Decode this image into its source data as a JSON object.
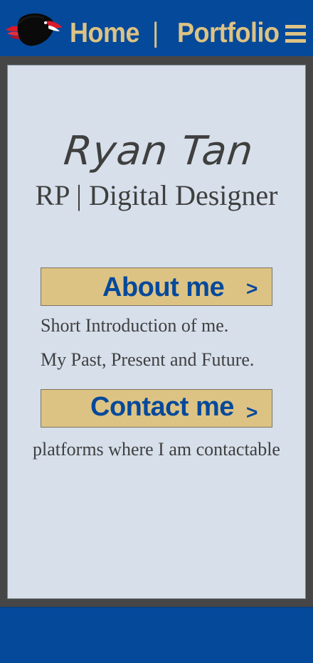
{
  "header": {
    "logo_icon": "eagle-logo-icon",
    "nav": {
      "home": "Home",
      "separator": "|",
      "portfolio": "Portfolio"
    },
    "menu_icon": "hamburger-menu-icon"
  },
  "hero": {
    "name": "Ryan Tan",
    "role": "RP | Digital Designer"
  },
  "sections": {
    "about": {
      "button_label": "About me",
      "arrow": ">",
      "lines": [
        "Short Introduction of me.",
        "My Past, Present and Future."
      ]
    },
    "contact": {
      "button_label": "Contact me",
      "arrow": ">",
      "lines": [
        "platforms where I am contactable"
      ]
    }
  },
  "colors": {
    "brand_blue": "#05499b",
    "accent_gold": "#ddc383",
    "frame_gray": "#464646",
    "card_bg": "#d6dfea",
    "text_dark": "#3f3f3f"
  }
}
